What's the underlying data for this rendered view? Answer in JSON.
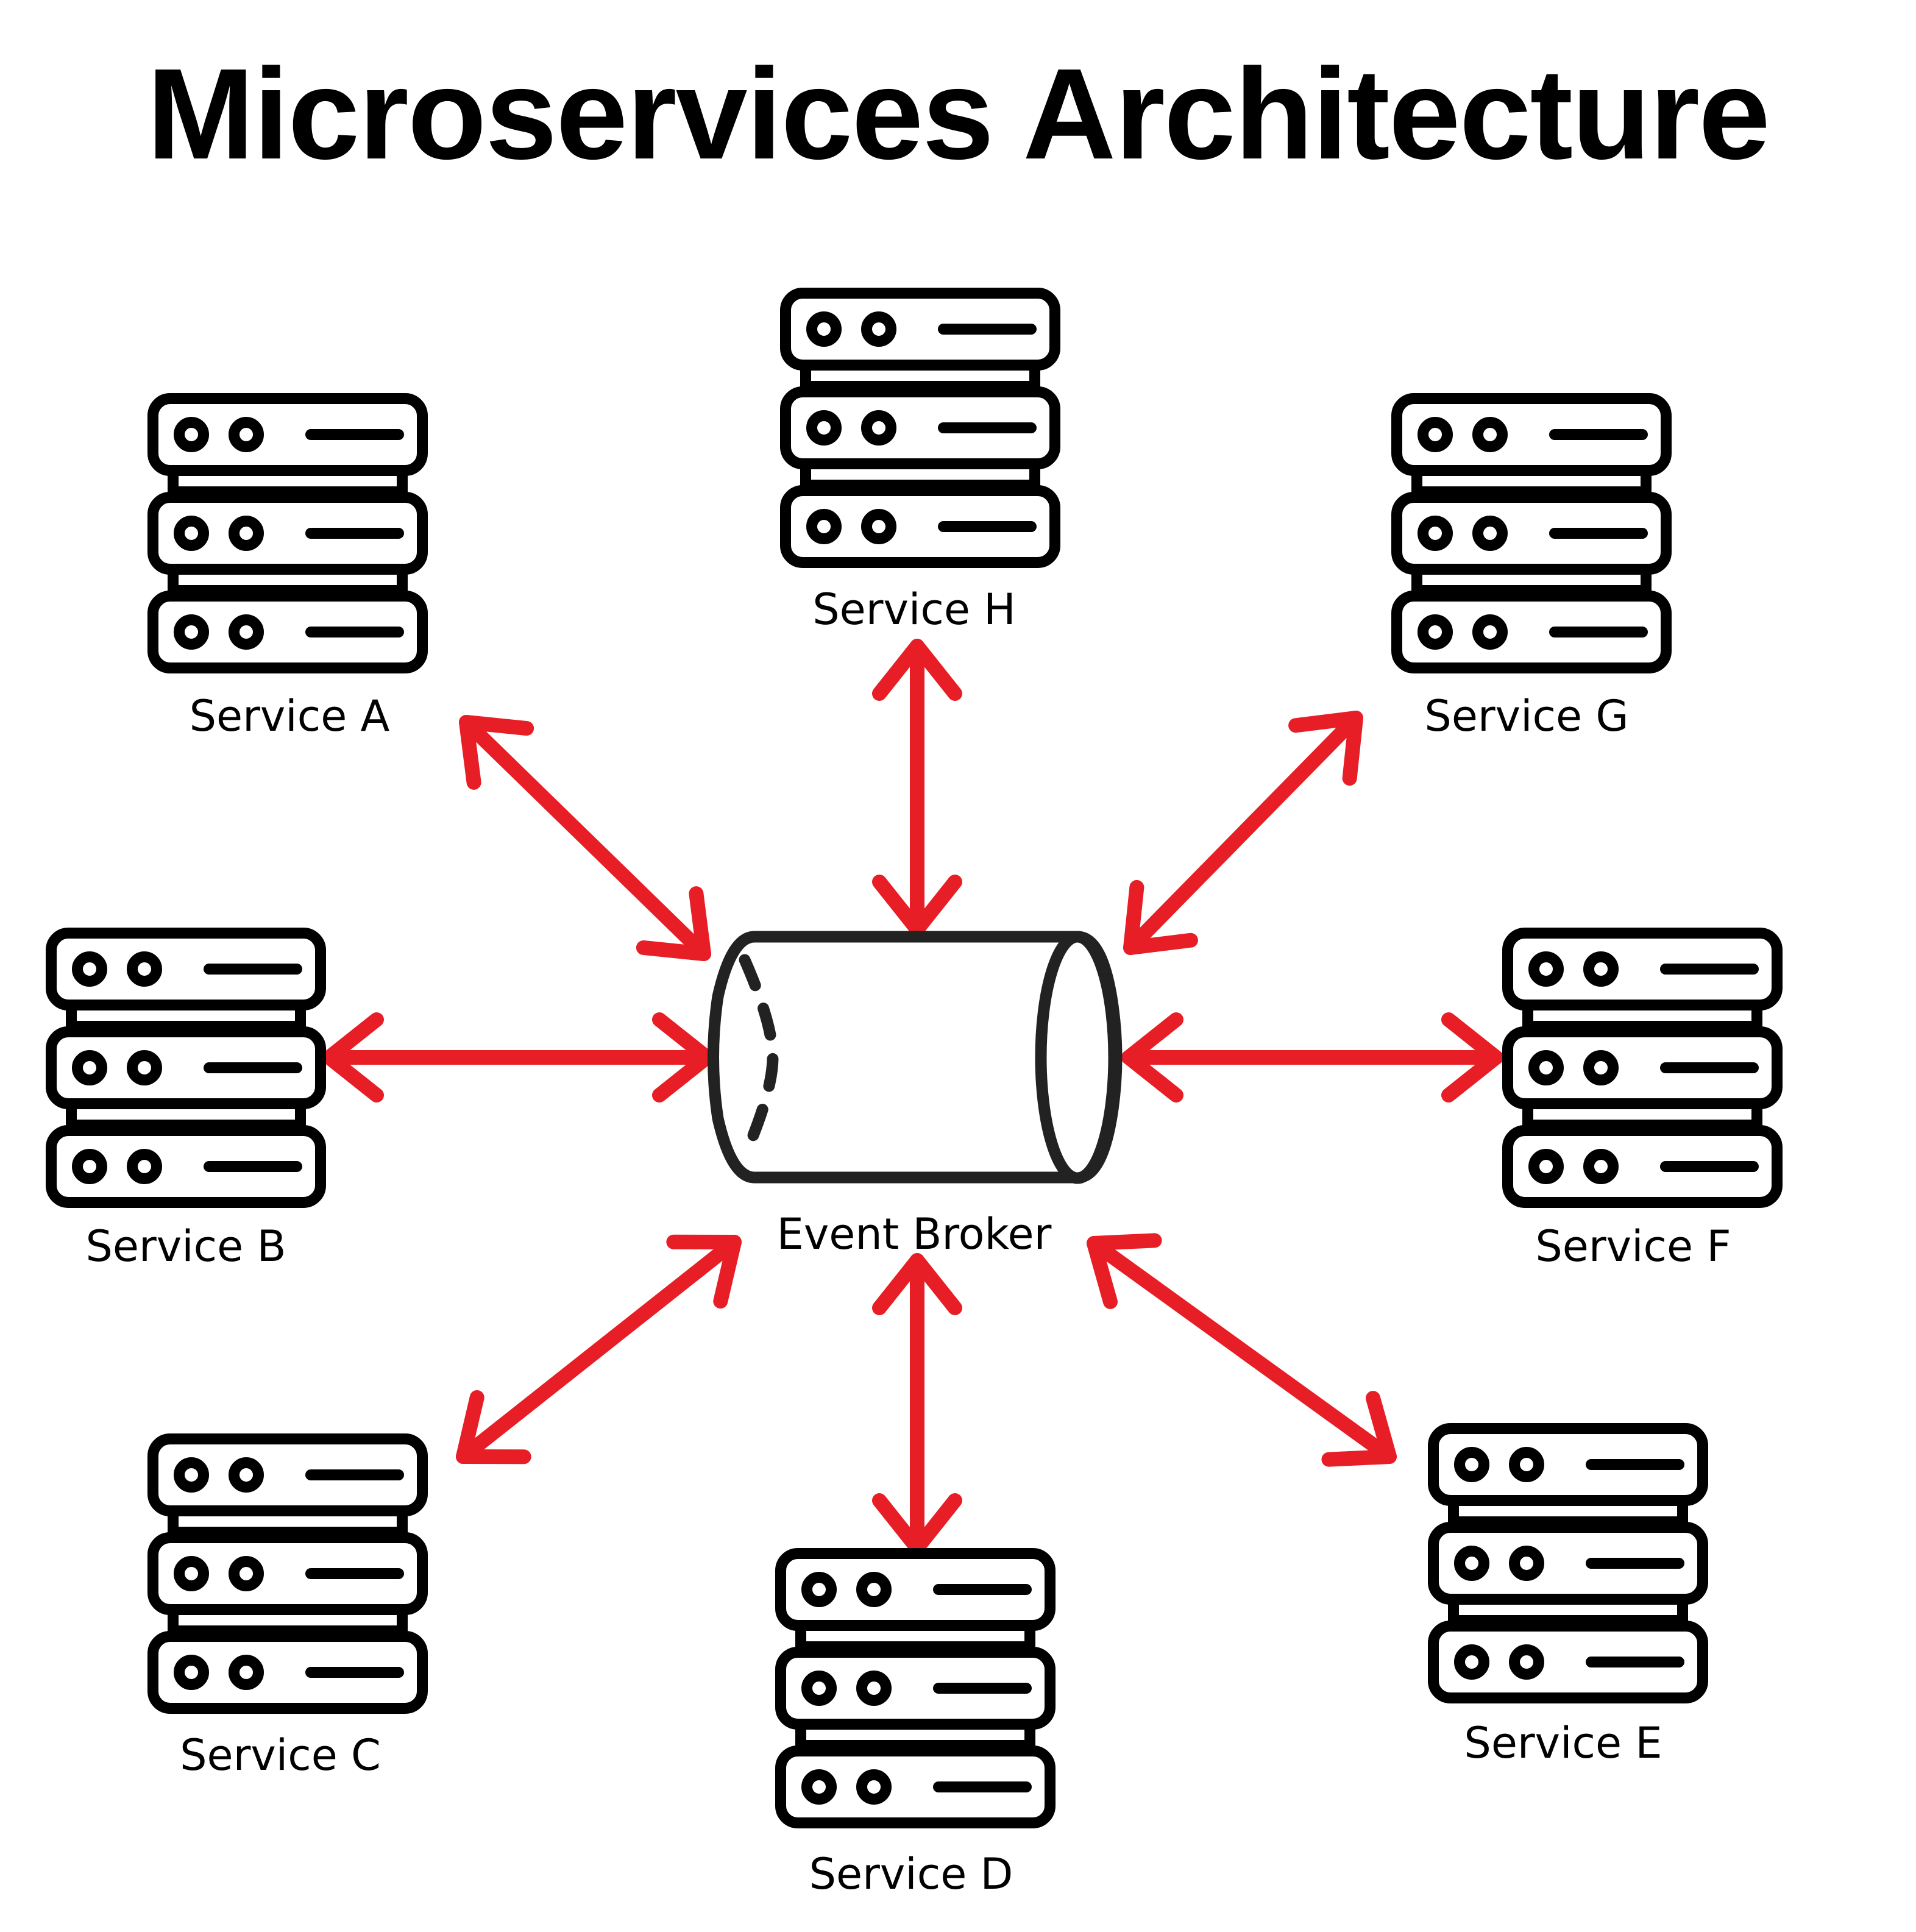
{
  "title": "Microservices Architecture",
  "colors": {
    "arrow": "#E81E26",
    "stroke": "#000000",
    "broker_stroke": "#222222",
    "background": "#FFFFFF"
  },
  "broker": {
    "label": "Event Broker",
    "icon": "cylinder-icon"
  },
  "services": [
    {
      "id": "A",
      "label": "Service A",
      "icon": "server-rack-icon"
    },
    {
      "id": "B",
      "label": "Service B",
      "icon": "server-rack-icon"
    },
    {
      "id": "C",
      "label": "Service C",
      "icon": "server-rack-icon"
    },
    {
      "id": "D",
      "label": "Service D",
      "icon": "server-rack-icon"
    },
    {
      "id": "E",
      "label": "Service E",
      "icon": "server-rack-icon"
    },
    {
      "id": "F",
      "label": "Service F",
      "icon": "server-rack-icon"
    },
    {
      "id": "G",
      "label": "Service G",
      "icon": "server-rack-icon"
    },
    {
      "id": "H",
      "label": "Service H",
      "icon": "server-rack-icon"
    }
  ],
  "connections": [
    {
      "from": "Event Broker",
      "to": "Service A",
      "direction": "bidirectional"
    },
    {
      "from": "Event Broker",
      "to": "Service B",
      "direction": "bidirectional"
    },
    {
      "from": "Event Broker",
      "to": "Service C",
      "direction": "bidirectional"
    },
    {
      "from": "Event Broker",
      "to": "Service D",
      "direction": "bidirectional"
    },
    {
      "from": "Event Broker",
      "to": "Service E",
      "direction": "bidirectional"
    },
    {
      "from": "Event Broker",
      "to": "Service F",
      "direction": "bidirectional"
    },
    {
      "from": "Event Broker",
      "to": "Service G",
      "direction": "bidirectional"
    },
    {
      "from": "Event Broker",
      "to": "Service H",
      "direction": "bidirectional"
    }
  ]
}
